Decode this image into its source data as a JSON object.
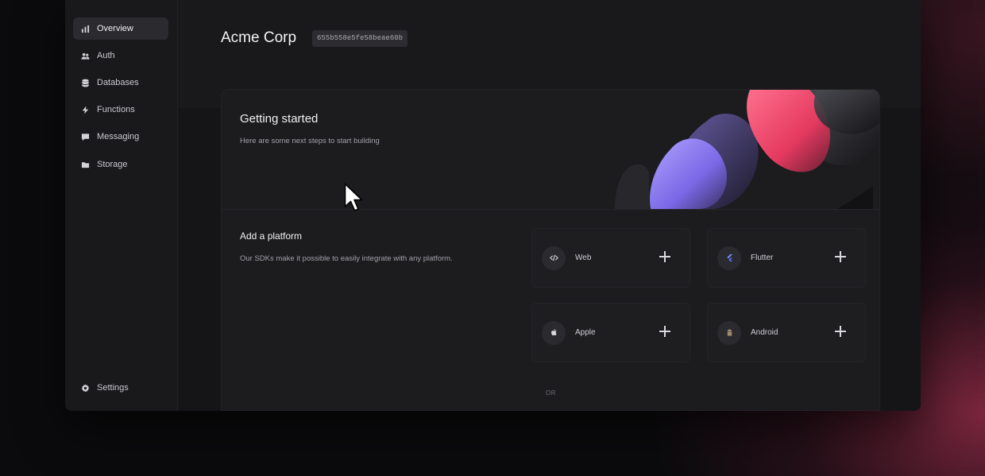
{
  "sidebar": {
    "items": [
      {
        "label": "Overview",
        "icon": "bar-chart-icon",
        "active": true
      },
      {
        "label": "Auth",
        "icon": "users-icon"
      },
      {
        "label": "Databases",
        "icon": "database-icon"
      },
      {
        "label": "Functions",
        "icon": "lightning-icon"
      },
      {
        "label": "Messaging",
        "icon": "chat-icon"
      },
      {
        "label": "Storage",
        "icon": "folder-icon"
      }
    ],
    "settings_label": "Settings"
  },
  "header": {
    "project_name": "Acme Corp",
    "project_id": "655b558e5fe58beae60b"
  },
  "getting_started": {
    "title": "Getting started",
    "subtitle": "Here are some next steps to start building"
  },
  "add_platform": {
    "title": "Add a platform",
    "description": "Our SDKs make it possible to easily integrate with any platform.",
    "platforms": [
      {
        "label": "Web",
        "icon": "code-icon"
      },
      {
        "label": "Flutter",
        "icon": "flutter-icon"
      },
      {
        "label": "Apple",
        "icon": "apple-icon"
      },
      {
        "label": "Android",
        "icon": "android-icon"
      }
    ],
    "or_label": "OR"
  },
  "colors": {
    "background": "#0b0b0d",
    "window": "#19191c",
    "accent_pink": "#e9446a",
    "accent_purple": "#8b7bf0"
  }
}
